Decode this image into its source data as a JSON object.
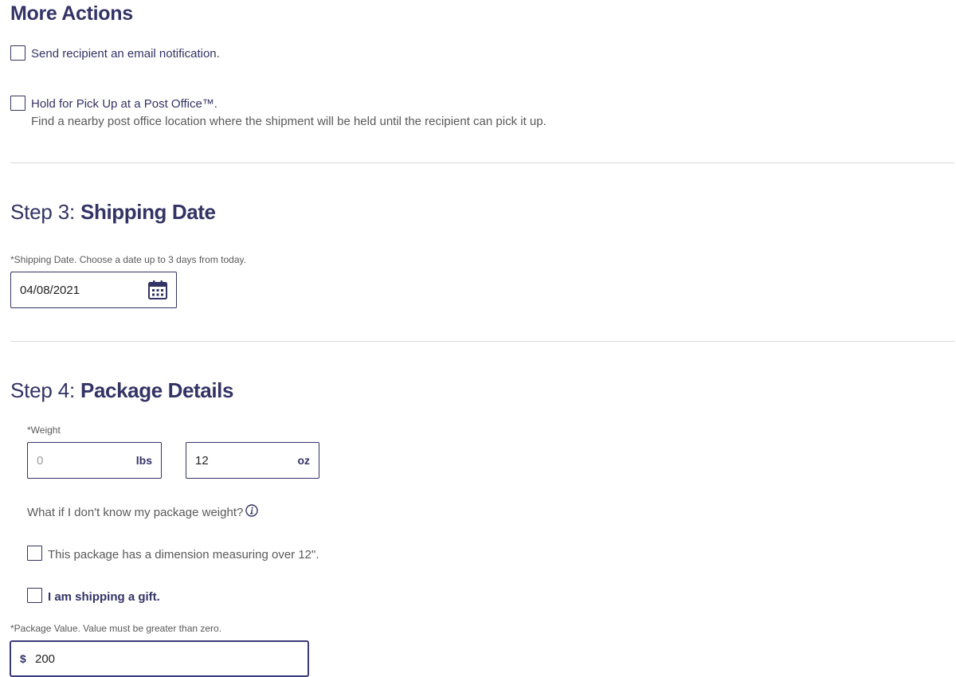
{
  "more_actions": {
    "title": "More Actions",
    "email_notification_label": "Send recipient an email notification.",
    "hold_label": "Hold for Pick Up at a Post Office™.",
    "hold_description": "Find a nearby post office location where the shipment will be held until the recipient can pick it up."
  },
  "step3": {
    "prefix": "Step 3: ",
    "title": "Shipping Date",
    "date_label": "*Shipping Date. Choose a date up to 3 days from today.",
    "date_value": "04/08/2021"
  },
  "step4": {
    "prefix": "Step 4: ",
    "title": "Package Details",
    "weight_label": "*Weight",
    "lbs_placeholder": "0",
    "lbs_unit": "lbs",
    "oz_value": "12",
    "oz_unit": "oz",
    "weight_help": "What if I don't know my package weight?",
    "dimension_label": "This package has a dimension measuring over 12\".",
    "gift_label": "I am shipping a gift.",
    "value_label": "*Package Value. Value must be greater than zero.",
    "currency_symbol": "$",
    "value": "200"
  },
  "colors": {
    "brand": "#333366",
    "divider": "#d9d9d9",
    "muted_text": "#595959"
  },
  "icons": {
    "calendar": "calendar-icon",
    "info": "info-icon"
  }
}
